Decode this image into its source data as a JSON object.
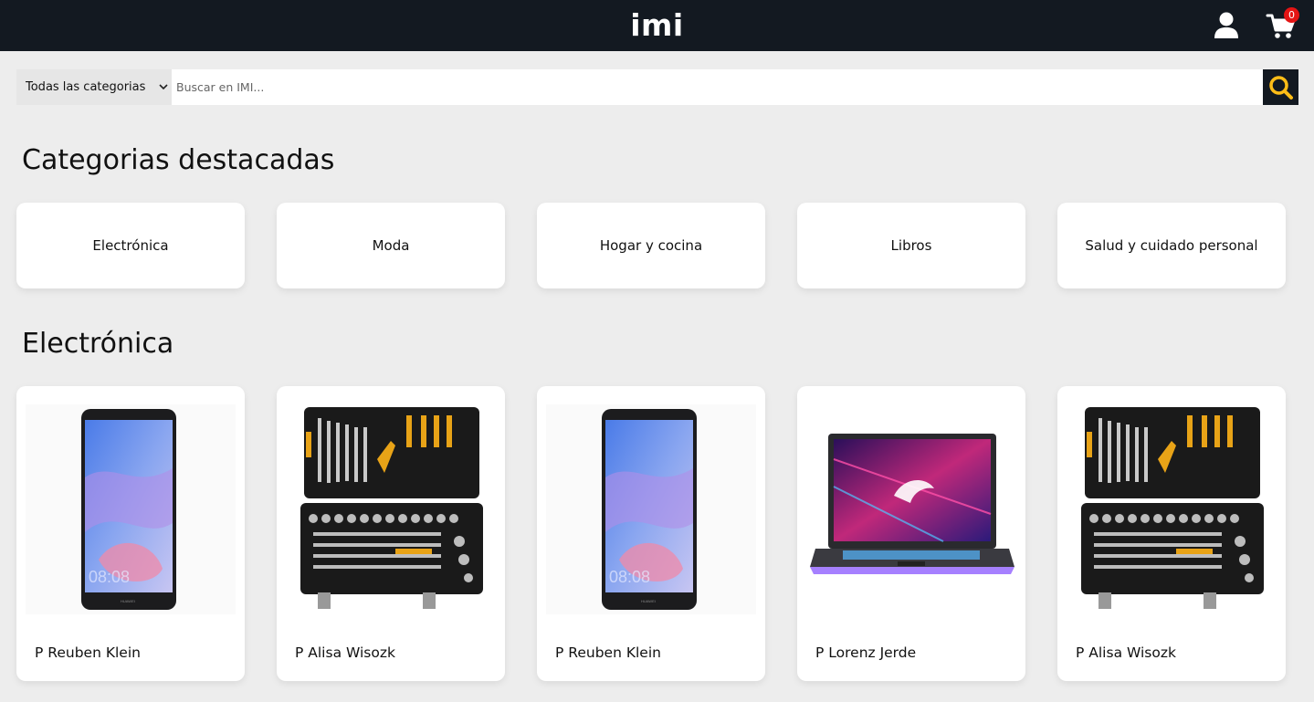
{
  "header": {
    "logo": "imi",
    "cart_count": "0",
    "account_icon": "user-icon",
    "cart_icon": "shopping-cart-icon"
  },
  "search": {
    "category_selected": "Todas las categorias",
    "placeholder": "Buscar en IMI...",
    "search_icon": "magnifier-icon"
  },
  "featured": {
    "title": "Categorias destacadas",
    "categories": [
      "Electrónica",
      "Moda",
      "Hogar y cocina",
      "Libros",
      "Salud y cuidado personal"
    ]
  },
  "section": {
    "title": "Electrónica",
    "products": [
      {
        "name": "P Reuben Klein",
        "image": "smartphone-image"
      },
      {
        "name": "P Alisa Wisozk",
        "image": "toolkit-case-image"
      },
      {
        "name": "P Reuben Klein",
        "image": "smartphone-image"
      },
      {
        "name": "P Lorenz Jerde",
        "image": "gaming-laptop-image"
      },
      {
        "name": "P Alisa Wisozk",
        "image": "toolkit-case-image"
      }
    ]
  },
  "colors": {
    "header_bg": "#131921",
    "page_bg": "#ededed",
    "accent_yellow": "#febd17",
    "badge_red": "#e41414"
  },
  "phone_time": "08:08"
}
